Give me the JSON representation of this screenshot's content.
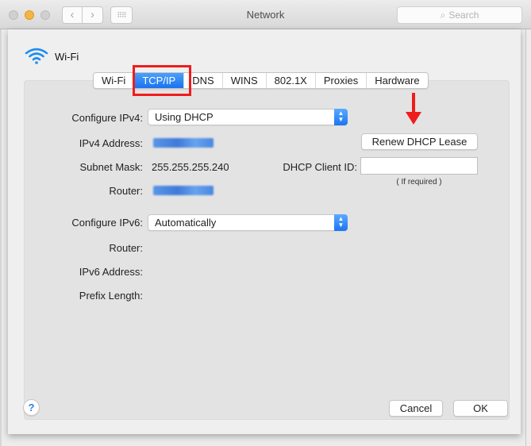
{
  "window": {
    "title": "Network",
    "search_placeholder": "Search",
    "back_glyph": "‹",
    "forward_glyph": "›",
    "grid_glyph": "⠿⠿"
  },
  "interface": {
    "name": "Wi-Fi",
    "icon": "wifi-icon"
  },
  "tabs": [
    {
      "label": "Wi-Fi",
      "active": false
    },
    {
      "label": "TCP/IP",
      "active": true
    },
    {
      "label": "DNS",
      "active": false
    },
    {
      "label": "WINS",
      "active": false
    },
    {
      "label": "802.1X",
      "active": false
    },
    {
      "label": "Proxies",
      "active": false
    },
    {
      "label": "Hardware",
      "active": false
    }
  ],
  "ipv4": {
    "configure_label": "Configure IPv4:",
    "configure_value": "Using DHCP",
    "address_label": "IPv4 Address:",
    "address_value": "[redacted]",
    "subnet_label": "Subnet Mask:",
    "subnet_value": "255.255.255.240",
    "router_label": "Router:",
    "router_value": "[redacted]"
  },
  "dhcp": {
    "renew_button": "Renew DHCP Lease",
    "client_id_label": "DHCP Client ID:",
    "client_id_value": "",
    "client_id_hint": "( If required )"
  },
  "ipv6": {
    "configure_label": "Configure IPv6:",
    "configure_value": "Automatically",
    "router_label": "Router:",
    "address_label": "IPv6 Address:",
    "prefix_label": "Prefix Length:"
  },
  "footer": {
    "help_glyph": "?",
    "cancel": "Cancel",
    "ok": "OK"
  },
  "annotations": {
    "highlight_color": "#f01c1c"
  }
}
